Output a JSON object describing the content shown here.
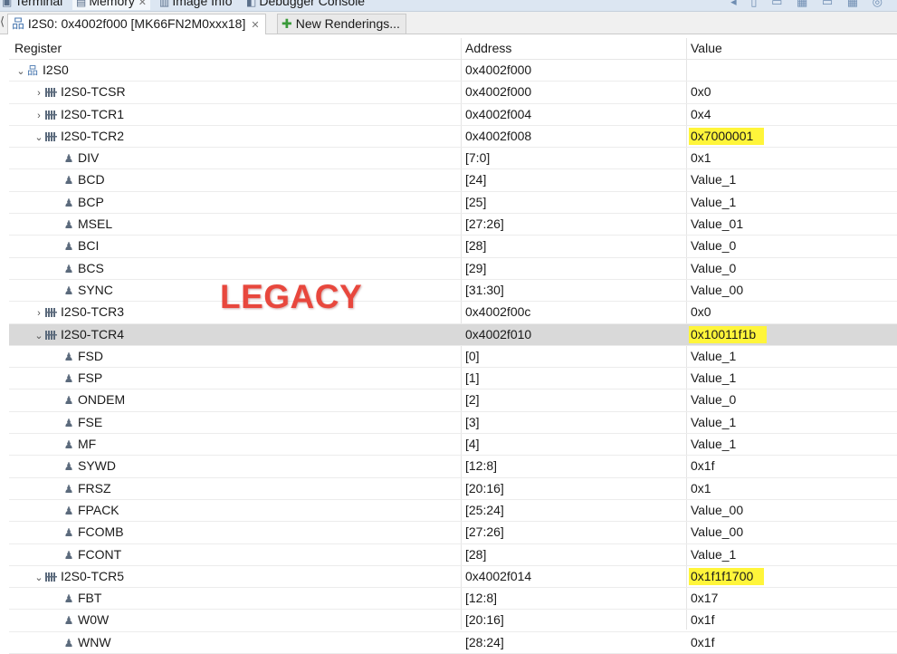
{
  "top_tabs": [
    {
      "label": "Terminal",
      "icon": "terminal-icon"
    },
    {
      "label": "Memory",
      "icon": "memory-icon",
      "active": true
    },
    {
      "label": "Image Info",
      "icon": "image-info-icon"
    },
    {
      "label": "Debugger Console",
      "icon": "debugger-console-icon"
    }
  ],
  "editor_tabs": [
    {
      "label": "I2S0: 0x4002f000 [MK66FN2M0xxx18]",
      "icon": "peripheral-icon",
      "closable": true
    },
    {
      "label": "New Renderings...",
      "icon": "plus-icon"
    }
  ],
  "columns": {
    "register": "Register",
    "address": "Address",
    "value": "Value"
  },
  "rows": [
    {
      "level": 0,
      "kind": "peripheral",
      "expand": "open",
      "name": "I2S0",
      "address": "0x4002f000",
      "value": ""
    },
    {
      "level": 1,
      "kind": "register",
      "expand": "closed",
      "name": "I2S0-TCSR",
      "address": "0x4002f000",
      "value": "0x0"
    },
    {
      "level": 1,
      "kind": "register",
      "expand": "closed",
      "name": "I2S0-TCR1",
      "address": "0x4002f004",
      "value": "0x4"
    },
    {
      "level": 1,
      "kind": "register",
      "expand": "open",
      "name": "I2S0-TCR2",
      "address": "0x4002f008",
      "value": "0x7000001",
      "highlight": true
    },
    {
      "level": 2,
      "kind": "field",
      "name": "DIV",
      "address": "[7:0]",
      "value": "0x1"
    },
    {
      "level": 2,
      "kind": "field",
      "name": "BCD",
      "address": "[24]",
      "value": "Value_1"
    },
    {
      "level": 2,
      "kind": "field",
      "name": "BCP",
      "address": "[25]",
      "value": "Value_1"
    },
    {
      "level": 2,
      "kind": "field",
      "name": "MSEL",
      "address": "[27:26]",
      "value": "Value_01"
    },
    {
      "level": 2,
      "kind": "field",
      "name": "BCI",
      "address": "[28]",
      "value": "Value_0"
    },
    {
      "level": 2,
      "kind": "field",
      "name": "BCS",
      "address": "[29]",
      "value": "Value_0"
    },
    {
      "level": 2,
      "kind": "field",
      "name": "SYNC",
      "address": "[31:30]",
      "value": "Value_00"
    },
    {
      "level": 1,
      "kind": "register",
      "expand": "closed",
      "name": "I2S0-TCR3",
      "address": "0x4002f00c",
      "value": "0x0"
    },
    {
      "level": 1,
      "kind": "register",
      "expand": "open",
      "name": "I2S0-TCR4",
      "address": "0x4002f010",
      "value": "0x10011f1b",
      "highlight": true,
      "selected": true
    },
    {
      "level": 2,
      "kind": "field",
      "name": "FSD",
      "address": "[0]",
      "value": "Value_1"
    },
    {
      "level": 2,
      "kind": "field",
      "name": "FSP",
      "address": "[1]",
      "value": "Value_1"
    },
    {
      "level": 2,
      "kind": "field",
      "name": "ONDEM",
      "address": "[2]",
      "value": "Value_0"
    },
    {
      "level": 2,
      "kind": "field",
      "name": "FSE",
      "address": "[3]",
      "value": "Value_1"
    },
    {
      "level": 2,
      "kind": "field",
      "name": "MF",
      "address": "[4]",
      "value": "Value_1"
    },
    {
      "level": 2,
      "kind": "field",
      "name": "SYWD",
      "address": "[12:8]",
      "value": "0x1f"
    },
    {
      "level": 2,
      "kind": "field",
      "name": "FRSZ",
      "address": "[20:16]",
      "value": "0x1"
    },
    {
      "level": 2,
      "kind": "field",
      "name": "FPACK",
      "address": "[25:24]",
      "value": "Value_00"
    },
    {
      "level": 2,
      "kind": "field",
      "name": "FCOMB",
      "address": "[27:26]",
      "value": "Value_00"
    },
    {
      "level": 2,
      "kind": "field",
      "name": "FCONT",
      "address": "[28]",
      "value": "Value_1"
    },
    {
      "level": 1,
      "kind": "register",
      "expand": "open",
      "name": "I2S0-TCR5",
      "address": "0x4002f014",
      "value": "0x1f1f1700",
      "highlight": true
    },
    {
      "level": 2,
      "kind": "field",
      "name": "FBT",
      "address": "[12:8]",
      "value": "0x17"
    },
    {
      "level": 2,
      "kind": "field",
      "name": "W0W",
      "address": "[20:16]",
      "value": "0x1f"
    },
    {
      "level": 2,
      "kind": "field",
      "name": "WNW",
      "address": "[28:24]",
      "value": "0x1f"
    }
  ],
  "overlay_text": "LEGACY",
  "colors": {
    "highlight": "#fff53a",
    "selected_row": "#d9d9d9",
    "overlay": "#e8473d"
  }
}
